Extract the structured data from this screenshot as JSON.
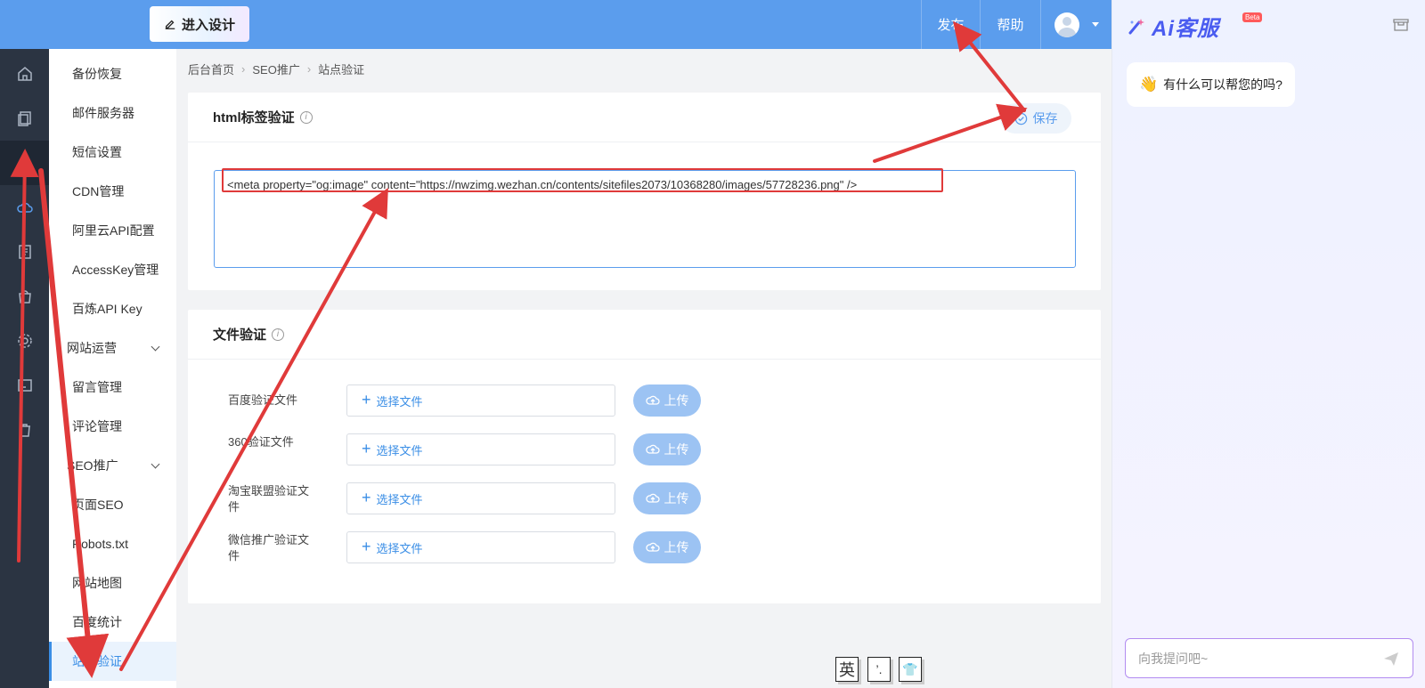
{
  "topbar": {
    "design_label": "进入设计",
    "publish_label": "发布",
    "help_label": "帮助"
  },
  "menu": {
    "items": [
      {
        "label": "备份恢复",
        "type": "item"
      },
      {
        "label": "邮件服务器",
        "type": "item"
      },
      {
        "label": "短信设置",
        "type": "item"
      },
      {
        "label": "CDN管理",
        "type": "item"
      },
      {
        "label": "阿里云API配置",
        "type": "item"
      },
      {
        "label": "AccessKey管理",
        "type": "item"
      },
      {
        "label": "百炼API Key",
        "type": "item"
      },
      {
        "label": "网站运营",
        "type": "group"
      },
      {
        "label": "留言管理",
        "type": "item"
      },
      {
        "label": "评论管理",
        "type": "item"
      },
      {
        "label": "SEO推广",
        "type": "group"
      },
      {
        "label": "页面SEO",
        "type": "item"
      },
      {
        "label": "Robots.txt",
        "type": "item"
      },
      {
        "label": "网站地图",
        "type": "item"
      },
      {
        "label": "百度统计",
        "type": "item"
      },
      {
        "label": "站点验证",
        "type": "item",
        "active": true
      }
    ]
  },
  "breadcrumb": [
    "后台首页",
    "SEO推广",
    "站点验证"
  ],
  "html_panel": {
    "title": "html标签验证",
    "save_label": "保存",
    "meta_value": "<meta property=\"og:image\" content=\"https://nwzimg.wezhan.cn/contents/sitefiles2073/10368280/images/57728236.png\" />"
  },
  "file_panel": {
    "title": "文件验证",
    "pick_label": "选择文件",
    "upload_label": "上传",
    "rows": [
      {
        "label": "百度验证文件"
      },
      {
        "label": "360验证文件"
      },
      {
        "label": "淘宝联盟验证文件"
      },
      {
        "label": "微信推广验证文件"
      }
    ]
  },
  "ime": [
    "英",
    "’.",
    "👕"
  ],
  "chat": {
    "brand": "Ai客服",
    "beta": "Beta",
    "greeting": "有什么可以帮您的吗?",
    "input_placeholder": "向我提问吧~"
  },
  "colors": {
    "topbar": "#5b9ded",
    "rail": "#2b3442",
    "accent": "#3a8ee6",
    "annotation": "#e03a3a"
  }
}
